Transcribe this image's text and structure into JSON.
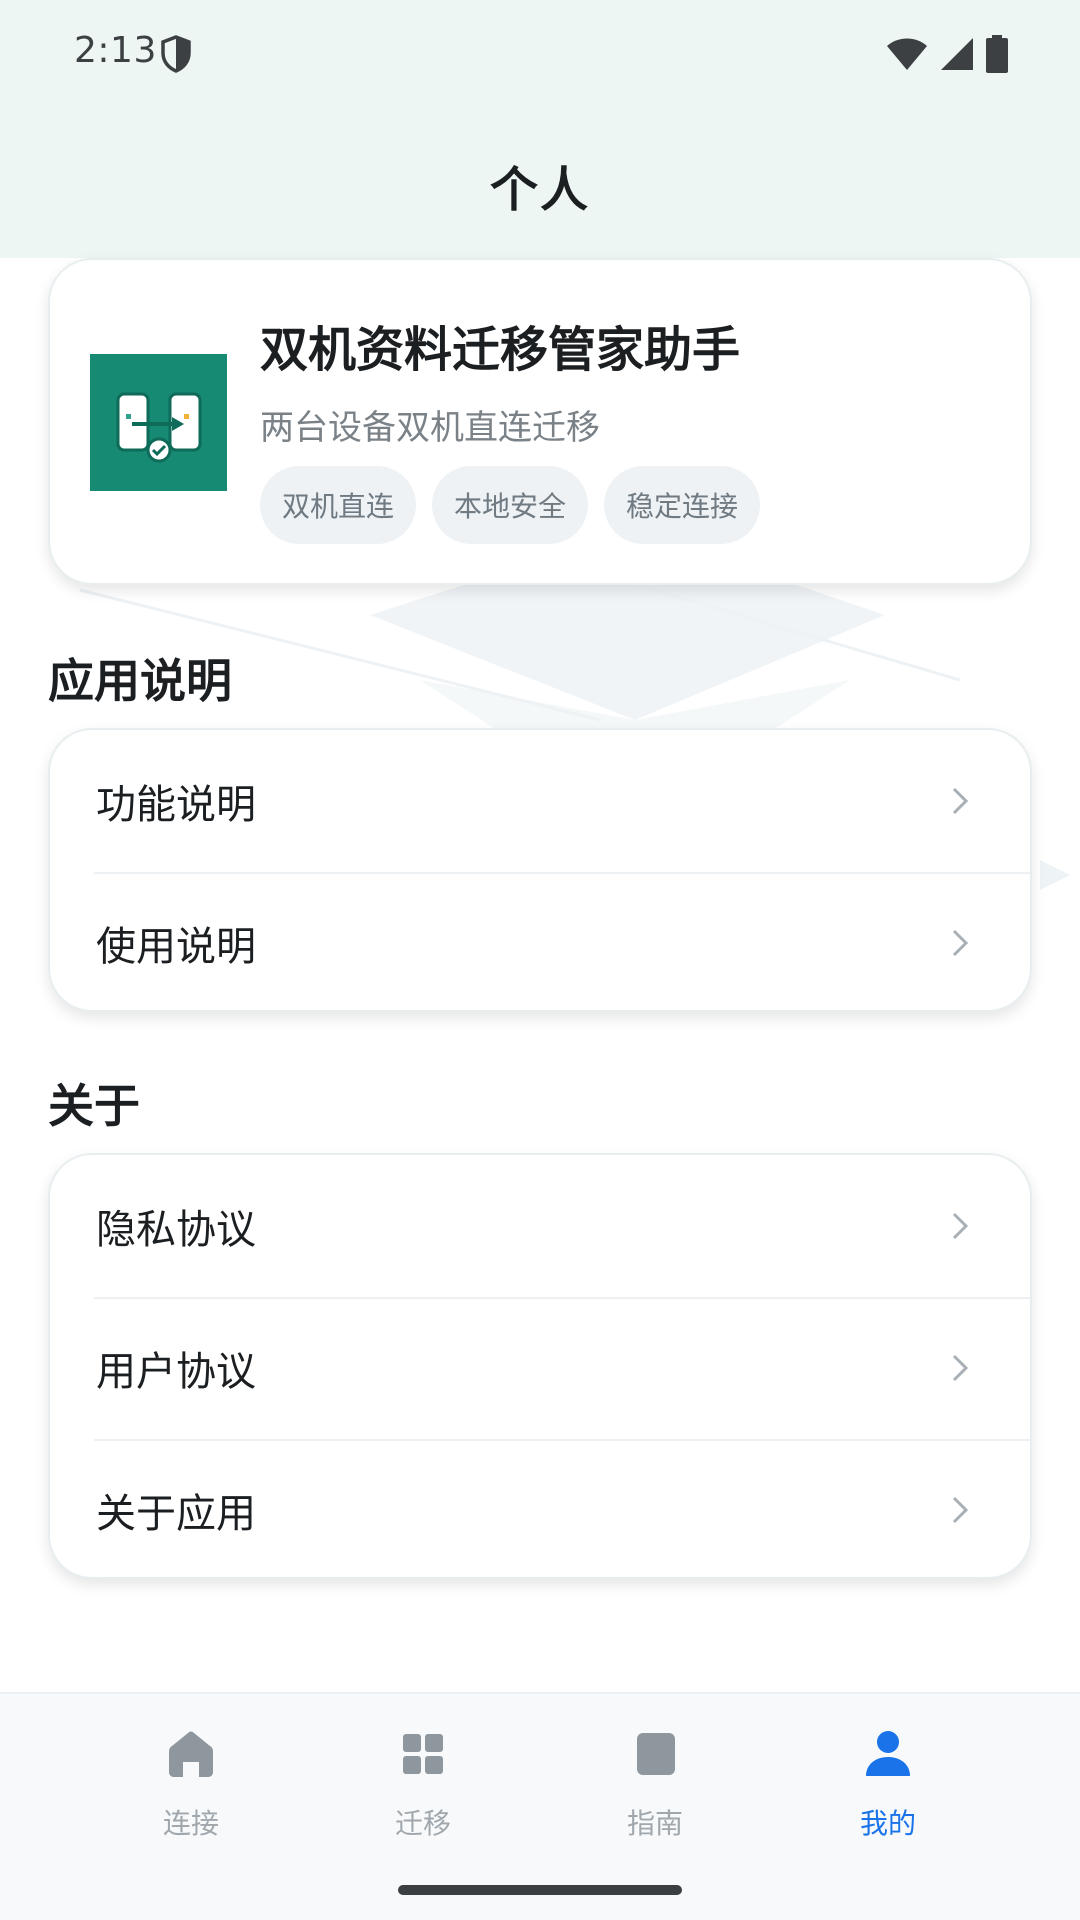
{
  "status_bar": {
    "time": "2:13",
    "icons": [
      "shield-icon",
      "wifi-icon",
      "signal-icon",
      "battery-icon"
    ]
  },
  "header": {
    "title": "个人"
  },
  "app_card": {
    "name": "双机资料迁移管家助手",
    "subtitle": "两台设备双机直连迁移",
    "tags": [
      "双机直连",
      "本地安全",
      "稳定连接"
    ],
    "logo_color": "#178a73"
  },
  "sections": [
    {
      "title": "应用说明",
      "items": [
        {
          "label": "功能说明"
        },
        {
          "label": "使用说明"
        }
      ]
    },
    {
      "title": "关于",
      "items": [
        {
          "label": "隐私协议"
        },
        {
          "label": "用户协议"
        },
        {
          "label": "关于应用"
        }
      ]
    }
  ],
  "bottom_nav": {
    "items": [
      {
        "label": "连接",
        "icon": "home-icon",
        "active": false
      },
      {
        "label": "迁移",
        "icon": "grid-icon",
        "active": false
      },
      {
        "label": "指南",
        "icon": "book-icon",
        "active": false
      },
      {
        "label": "我的",
        "icon": "person-icon",
        "active": true
      }
    ],
    "active_color": "#1a73e8",
    "inactive_color": "#a0a7ad"
  }
}
